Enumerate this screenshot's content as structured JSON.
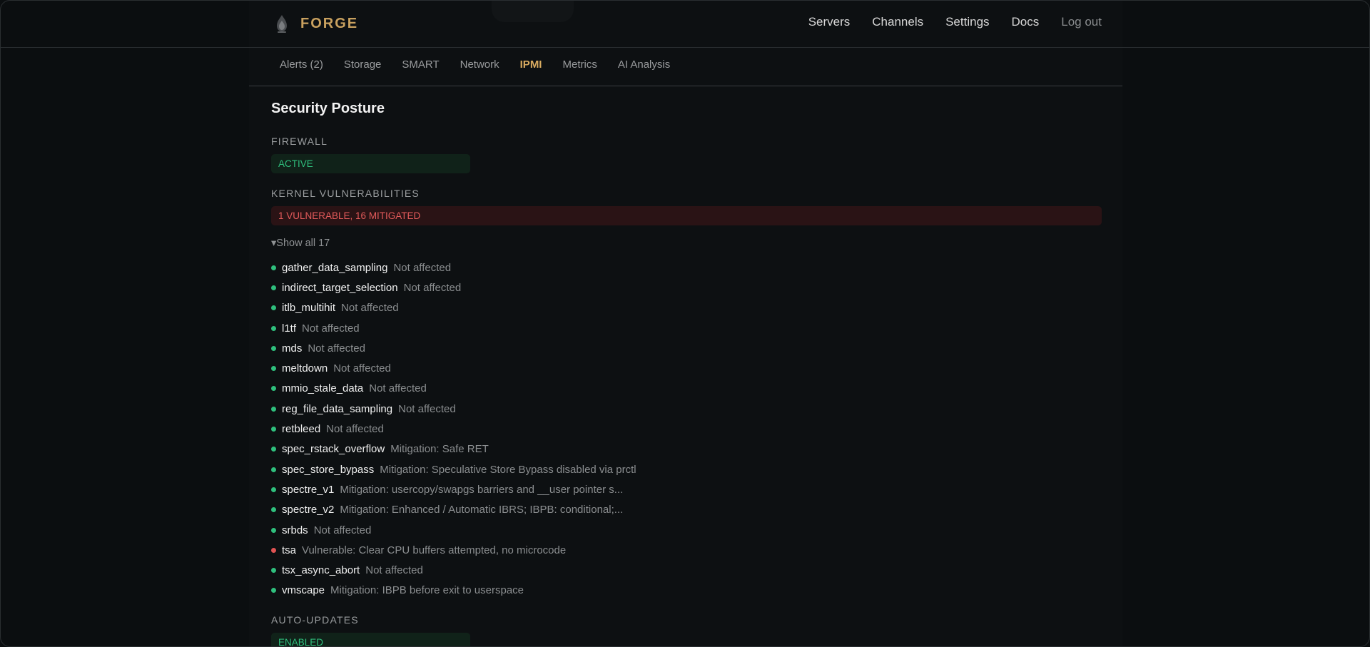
{
  "brand": {
    "name": "FORGE",
    "icon": "flame-icon"
  },
  "nav": {
    "items": [
      "Servers",
      "Channels",
      "Settings",
      "Docs"
    ],
    "logout": "Log out"
  },
  "tabs": [
    {
      "label": "Alerts (2)",
      "active": false
    },
    {
      "label": "Storage",
      "active": false
    },
    {
      "label": "SMART",
      "active": false
    },
    {
      "label": "Network",
      "active": false
    },
    {
      "label": "IPMI",
      "active": true
    },
    {
      "label": "Metrics",
      "active": false
    },
    {
      "label": "AI Analysis",
      "active": false
    }
  ],
  "security": {
    "title": "Security Posture",
    "firewall": {
      "label": "FIREWALL",
      "status": "ACTIVE"
    },
    "kernel": {
      "label": "KERNEL VULNERABILITIES",
      "summary": "1 VULNERABLE, 16 MITIGATED",
      "toggle": "▾Show all 17",
      "items": [
        {
          "name": "gather_data_sampling",
          "status": "Not affected",
          "state": "ok"
        },
        {
          "name": "indirect_target_selection",
          "status": "Not affected",
          "state": "ok"
        },
        {
          "name": "itlb_multihit",
          "status": "Not affected",
          "state": "ok"
        },
        {
          "name": "l1tf",
          "status": "Not affected",
          "state": "ok"
        },
        {
          "name": "mds",
          "status": "Not affected",
          "state": "ok"
        },
        {
          "name": "meltdown",
          "status": "Not affected",
          "state": "ok"
        },
        {
          "name": "mmio_stale_data",
          "status": "Not affected",
          "state": "ok"
        },
        {
          "name": "reg_file_data_sampling",
          "status": "Not affected",
          "state": "ok"
        },
        {
          "name": "retbleed",
          "status": "Not affected",
          "state": "ok"
        },
        {
          "name": "spec_rstack_overflow",
          "status": "Mitigation: Safe RET",
          "state": "ok"
        },
        {
          "name": "spec_store_bypass",
          "status": "Mitigation: Speculative Store Bypass disabled via prctl",
          "state": "ok"
        },
        {
          "name": "spectre_v1",
          "status": "Mitigation: usercopy/swapgs barriers and __user pointer s...",
          "state": "ok"
        },
        {
          "name": "spectre_v2",
          "status": "Mitigation: Enhanced / Automatic IBRS; IBPB: conditional;...",
          "state": "ok"
        },
        {
          "name": "srbds",
          "status": "Not affected",
          "state": "ok"
        },
        {
          "name": "tsa",
          "status": "Vulnerable: Clear CPU buffers attempted, no microcode",
          "state": "bad"
        },
        {
          "name": "tsx_async_abort",
          "status": "Not affected",
          "state": "ok"
        },
        {
          "name": "vmscape",
          "status": "Mitigation: IBPB before exit to userspace",
          "state": "ok"
        }
      ]
    },
    "auto_updates": {
      "label": "AUTO-UPDATES",
      "status": "ENABLED"
    }
  },
  "colors": {
    "accent": "#c9a15f",
    "ok": "#2fbf7d",
    "vulnerable": "#e05353"
  }
}
